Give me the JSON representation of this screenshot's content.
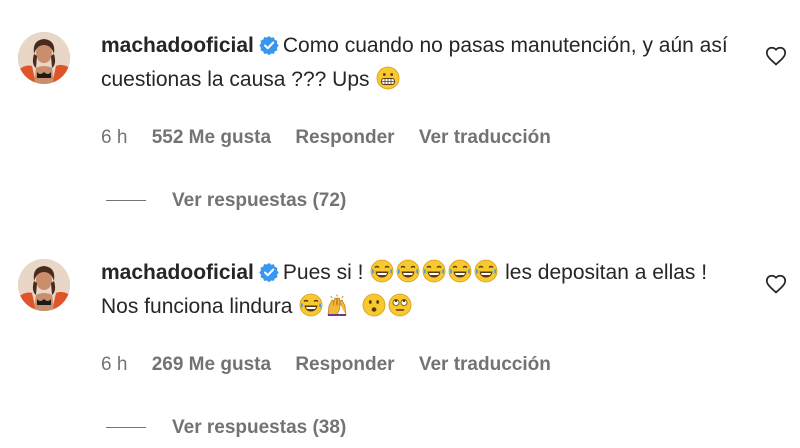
{
  "comments": [
    {
      "username": "machadooficial",
      "text_part1": "Como cuando no pasas manutención, y aún así cuestionas la causa ??? Ups",
      "time": "6 h",
      "likes": "552 Me gusta",
      "reply_label": "Responder",
      "translate_label": "Ver traducción",
      "view_replies": "Ver respuestas (72)"
    },
    {
      "username": "machadooficial",
      "text_part1": "Pues si !",
      "text_part2": "les depositan a ellas ! Nos funciona lindura",
      "time": "6 h",
      "likes": "269 Me gusta",
      "reply_label": "Responder",
      "translate_label": "Ver traducción",
      "view_replies": "Ver respuestas (38)"
    }
  ],
  "icons": {
    "verified": "verified-badge-icon",
    "heart": "heart-outline-icon",
    "emoji_grimace": "grimacing-face-emoji",
    "emoji_laugh": "tears-of-joy-emoji",
    "emoji_praise": "raising-hands-emoji",
    "emoji_surprised": "hushed-face-emoji",
    "emoji_rolleyes": "rolling-eyes-emoji"
  },
  "colors": {
    "verified": "#3897f0",
    "text": "#262626",
    "secondary": "#737373"
  }
}
